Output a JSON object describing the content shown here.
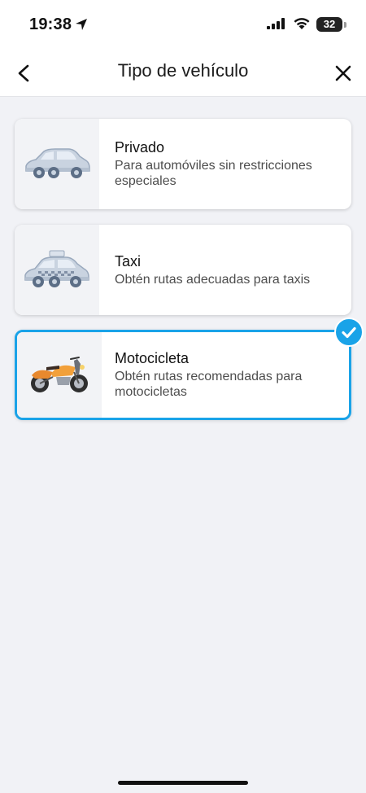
{
  "status_bar": {
    "time": "19:38",
    "battery": "32"
  },
  "header": {
    "title": "Tipo de vehículo"
  },
  "options": [
    {
      "title": "Privado",
      "description": "Para automóviles sin restricciones especiales",
      "selected": false,
      "icon": "car-icon"
    },
    {
      "title": "Taxi",
      "description": "Obtén rutas adecuadas para taxis",
      "selected": false,
      "icon": "taxi-icon"
    },
    {
      "title": "Motocicleta",
      "description": "Obtén rutas recomendadas para motocicletas",
      "selected": true,
      "icon": "motorcycle-icon"
    }
  ],
  "colors": {
    "accent": "#1aa3e8",
    "background": "#f1f2f6",
    "card": "#ffffff"
  }
}
